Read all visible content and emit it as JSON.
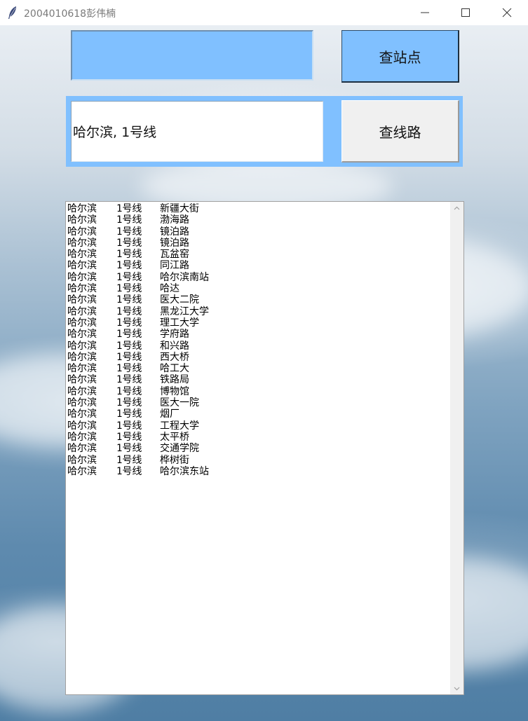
{
  "window": {
    "title": "2004010618彭伟楠",
    "icons": [
      "feather-icon",
      "minimize-icon",
      "maximize-icon",
      "close-icon"
    ]
  },
  "station_search": {
    "input_value": "",
    "button_label": "查站点"
  },
  "line_search": {
    "input_value": "哈尔滨, 1号线",
    "button_label": "查线路"
  },
  "results": {
    "rows": [
      {
        "city": "哈尔滨",
        "line": "1号线",
        "station": "新疆大街"
      },
      {
        "city": "哈尔滨",
        "line": "1号线",
        "station": "渤海路"
      },
      {
        "city": "哈尔滨",
        "line": "1号线",
        "station": "镜泊路"
      },
      {
        "city": "哈尔滨",
        "line": "1号线",
        "station": "镜泊路"
      },
      {
        "city": "哈尔滨",
        "line": "1号线",
        "station": "瓦盆窑"
      },
      {
        "city": "哈尔滨",
        "line": "1号线",
        "station": "同江路"
      },
      {
        "city": "哈尔滨",
        "line": "1号线",
        "station": "哈尔滨南站"
      },
      {
        "city": "哈尔滨",
        "line": "1号线",
        "station": "哈达"
      },
      {
        "city": "哈尔滨",
        "line": "1号线",
        "station": "医大二院"
      },
      {
        "city": "哈尔滨",
        "line": "1号线",
        "station": "黑龙江大学"
      },
      {
        "city": "哈尔滨",
        "line": "1号线",
        "station": "理工大学"
      },
      {
        "city": "哈尔滨",
        "line": "1号线",
        "station": "学府路"
      },
      {
        "city": "哈尔滨",
        "line": "1号线",
        "station": "和兴路"
      },
      {
        "city": "哈尔滨",
        "line": "1号线",
        "station": "西大桥"
      },
      {
        "city": "哈尔滨",
        "line": "1号线",
        "station": "哈工大"
      },
      {
        "city": "哈尔滨",
        "line": "1号线",
        "station": "铁路局"
      },
      {
        "city": "哈尔滨",
        "line": "1号线",
        "station": "博物馆"
      },
      {
        "city": "哈尔滨",
        "line": "1号线",
        "station": "医大一院"
      },
      {
        "city": "哈尔滨",
        "line": "1号线",
        "station": "烟厂"
      },
      {
        "city": "哈尔滨",
        "line": "1号线",
        "station": "工程大学"
      },
      {
        "city": "哈尔滨",
        "line": "1号线",
        "station": "太平桥"
      },
      {
        "city": "哈尔滨",
        "line": "1号线",
        "station": "交通学院"
      },
      {
        "city": "哈尔滨",
        "line": "1号线",
        "station": "桦树街"
      },
      {
        "city": "哈尔滨",
        "line": "1号线",
        "station": "哈尔滨东站"
      }
    ]
  },
  "colors": {
    "accent_blue": "#80c0ff",
    "button_gray": "#f0f0f0"
  }
}
